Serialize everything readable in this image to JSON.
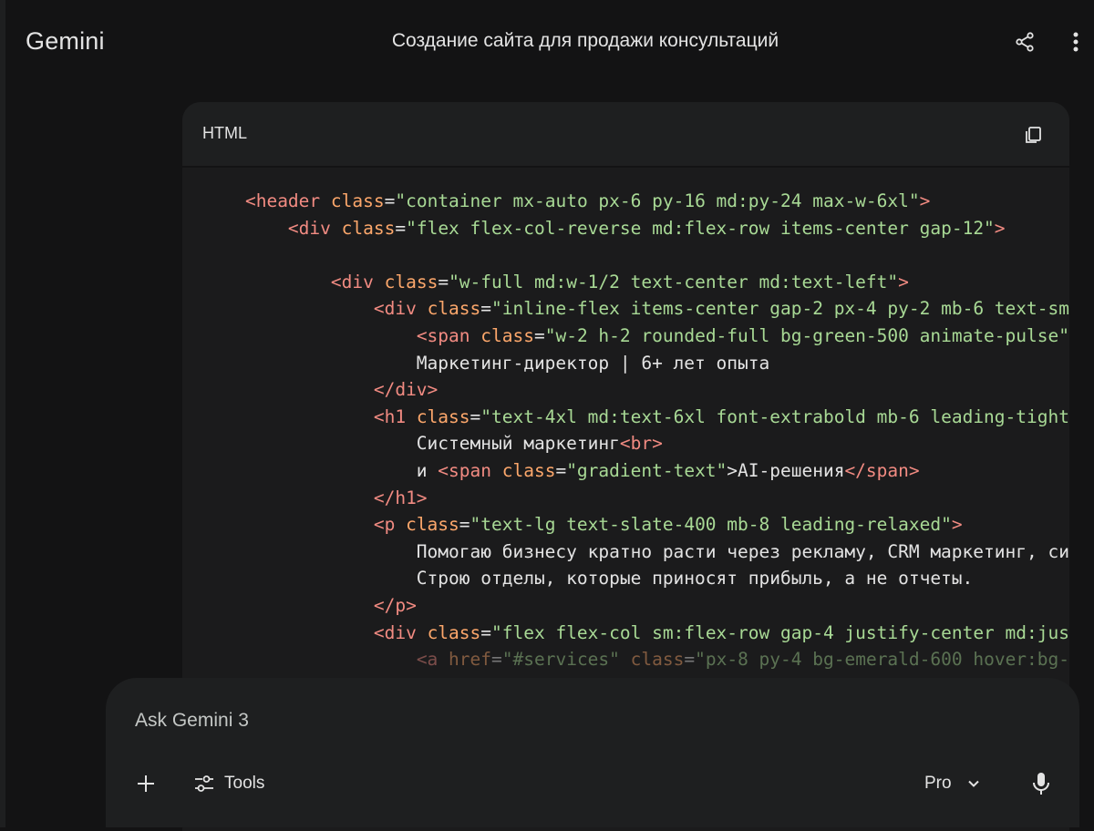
{
  "app": {
    "brand": "Gemini"
  },
  "conversation": {
    "title": "Создание сайта для продажи консультаций"
  },
  "icons": {
    "share": "share-icon",
    "more": "more-vert-icon",
    "copy": "copy-icon",
    "add": "plus-icon",
    "tools": "tune-icon",
    "model_dropdown": "chevron-down-icon",
    "mic": "microphone-icon"
  },
  "colors": {
    "background": "#131314",
    "surface": "#1e1f20",
    "code_tag": "#f28b82",
    "code_attr": "#fca76b",
    "code_string": "#a8d995",
    "text": "#e3e3e3"
  },
  "code_block": {
    "language": "HTML",
    "lines": [
      [
        {
          "t": "    "
        },
        {
          "t": "<header",
          "c": "tag"
        },
        {
          "t": " "
        },
        {
          "t": "class",
          "c": "attr"
        },
        {
          "t": "="
        },
        {
          "t": "\"container mx-auto px-6 py-16 md:py-24 max-w-6xl\"",
          "c": "str"
        },
        {
          "t": ">",
          "c": "tag"
        }
      ],
      [
        {
          "t": "        "
        },
        {
          "t": "<div",
          "c": "tag"
        },
        {
          "t": " "
        },
        {
          "t": "class",
          "c": "attr"
        },
        {
          "t": "="
        },
        {
          "t": "\"flex flex-col-reverse md:flex-row items-center gap-12\"",
          "c": "str"
        },
        {
          "t": ">",
          "c": "tag"
        }
      ],
      [],
      [
        {
          "t": "            "
        },
        {
          "t": "<div",
          "c": "tag"
        },
        {
          "t": " "
        },
        {
          "t": "class",
          "c": "attr"
        },
        {
          "t": "="
        },
        {
          "t": "\"w-full md:w-1/2 text-center md:text-left\"",
          "c": "str"
        },
        {
          "t": ">",
          "c": "tag"
        }
      ],
      [
        {
          "t": "                "
        },
        {
          "t": "<div",
          "c": "tag"
        },
        {
          "t": " "
        },
        {
          "t": "class",
          "c": "attr"
        },
        {
          "t": "="
        },
        {
          "t": "\"inline-flex items-center gap-2 px-4 py-2 mb-6 text-sm",
          "c": "str"
        }
      ],
      [
        {
          "t": "                    "
        },
        {
          "t": "<span",
          "c": "tag"
        },
        {
          "t": " "
        },
        {
          "t": "class",
          "c": "attr"
        },
        {
          "t": "="
        },
        {
          "t": "\"w-2 h-2 rounded-full bg-green-500 animate-pulse\"",
          "c": "str"
        }
      ],
      [
        {
          "t": "                    Маркетинг-директор | 6+ лет опыта"
        }
      ],
      [
        {
          "t": "                "
        },
        {
          "t": "</div>",
          "c": "tag"
        }
      ],
      [
        {
          "t": "                "
        },
        {
          "t": "<h1",
          "c": "tag"
        },
        {
          "t": " "
        },
        {
          "t": "class",
          "c": "attr"
        },
        {
          "t": "="
        },
        {
          "t": "\"text-4xl md:text-6xl font-extrabold mb-6 leading-tight",
          "c": "str"
        }
      ],
      [
        {
          "t": "                    Системный маркетинг"
        },
        {
          "t": "<br>",
          "c": "tag"
        }
      ],
      [
        {
          "t": "                    и "
        },
        {
          "t": "<span",
          "c": "tag"
        },
        {
          "t": " "
        },
        {
          "t": "class",
          "c": "attr"
        },
        {
          "t": "="
        },
        {
          "t": "\"gradient-text\"",
          "c": "str"
        },
        {
          "t": ">AI-решения"
        },
        {
          "t": "</span>",
          "c": "tag"
        }
      ],
      [
        {
          "t": "                "
        },
        {
          "t": "</h1>",
          "c": "tag"
        }
      ],
      [
        {
          "t": "                "
        },
        {
          "t": "<p",
          "c": "tag"
        },
        {
          "t": " "
        },
        {
          "t": "class",
          "c": "attr"
        },
        {
          "t": "="
        },
        {
          "t": "\"text-lg text-slate-400 mb-8 leading-relaxed\"",
          "c": "str"
        },
        {
          "t": ">",
          "c": "tag"
        }
      ],
      [
        {
          "t": "                    Помогаю бизнесу кратно расти через рекламу, CRM маркетинг, си"
        }
      ],
      [
        {
          "t": "                    Строю отделы, которые приносят прибыль, а не отчеты."
        }
      ],
      [
        {
          "t": "                "
        },
        {
          "t": "</p>",
          "c": "tag"
        }
      ],
      [
        {
          "t": "                "
        },
        {
          "t": "<div",
          "c": "tag"
        },
        {
          "t": " "
        },
        {
          "t": "class",
          "c": "attr"
        },
        {
          "t": "="
        },
        {
          "t": "\"flex flex-col sm:flex-row gap-4 justify-center md:jus",
          "c": "str"
        }
      ],
      [
        {
          "t": "                    "
        },
        {
          "t": "<a",
          "c": "tag"
        },
        {
          "t": " "
        },
        {
          "t": "href",
          "c": "attr"
        },
        {
          "t": "="
        },
        {
          "t": "\"#services\"",
          "c": "str"
        },
        {
          "t": " "
        },
        {
          "t": "class",
          "c": "attr"
        },
        {
          "t": "="
        },
        {
          "t": "\"px-8 py-4 bg-emerald-600 hover:bg-",
          "c": "str"
        }
      ]
    ]
  },
  "composer": {
    "placeholder": "Ask Gemini 3",
    "tools_label": "Tools",
    "model_label": "Pro"
  }
}
